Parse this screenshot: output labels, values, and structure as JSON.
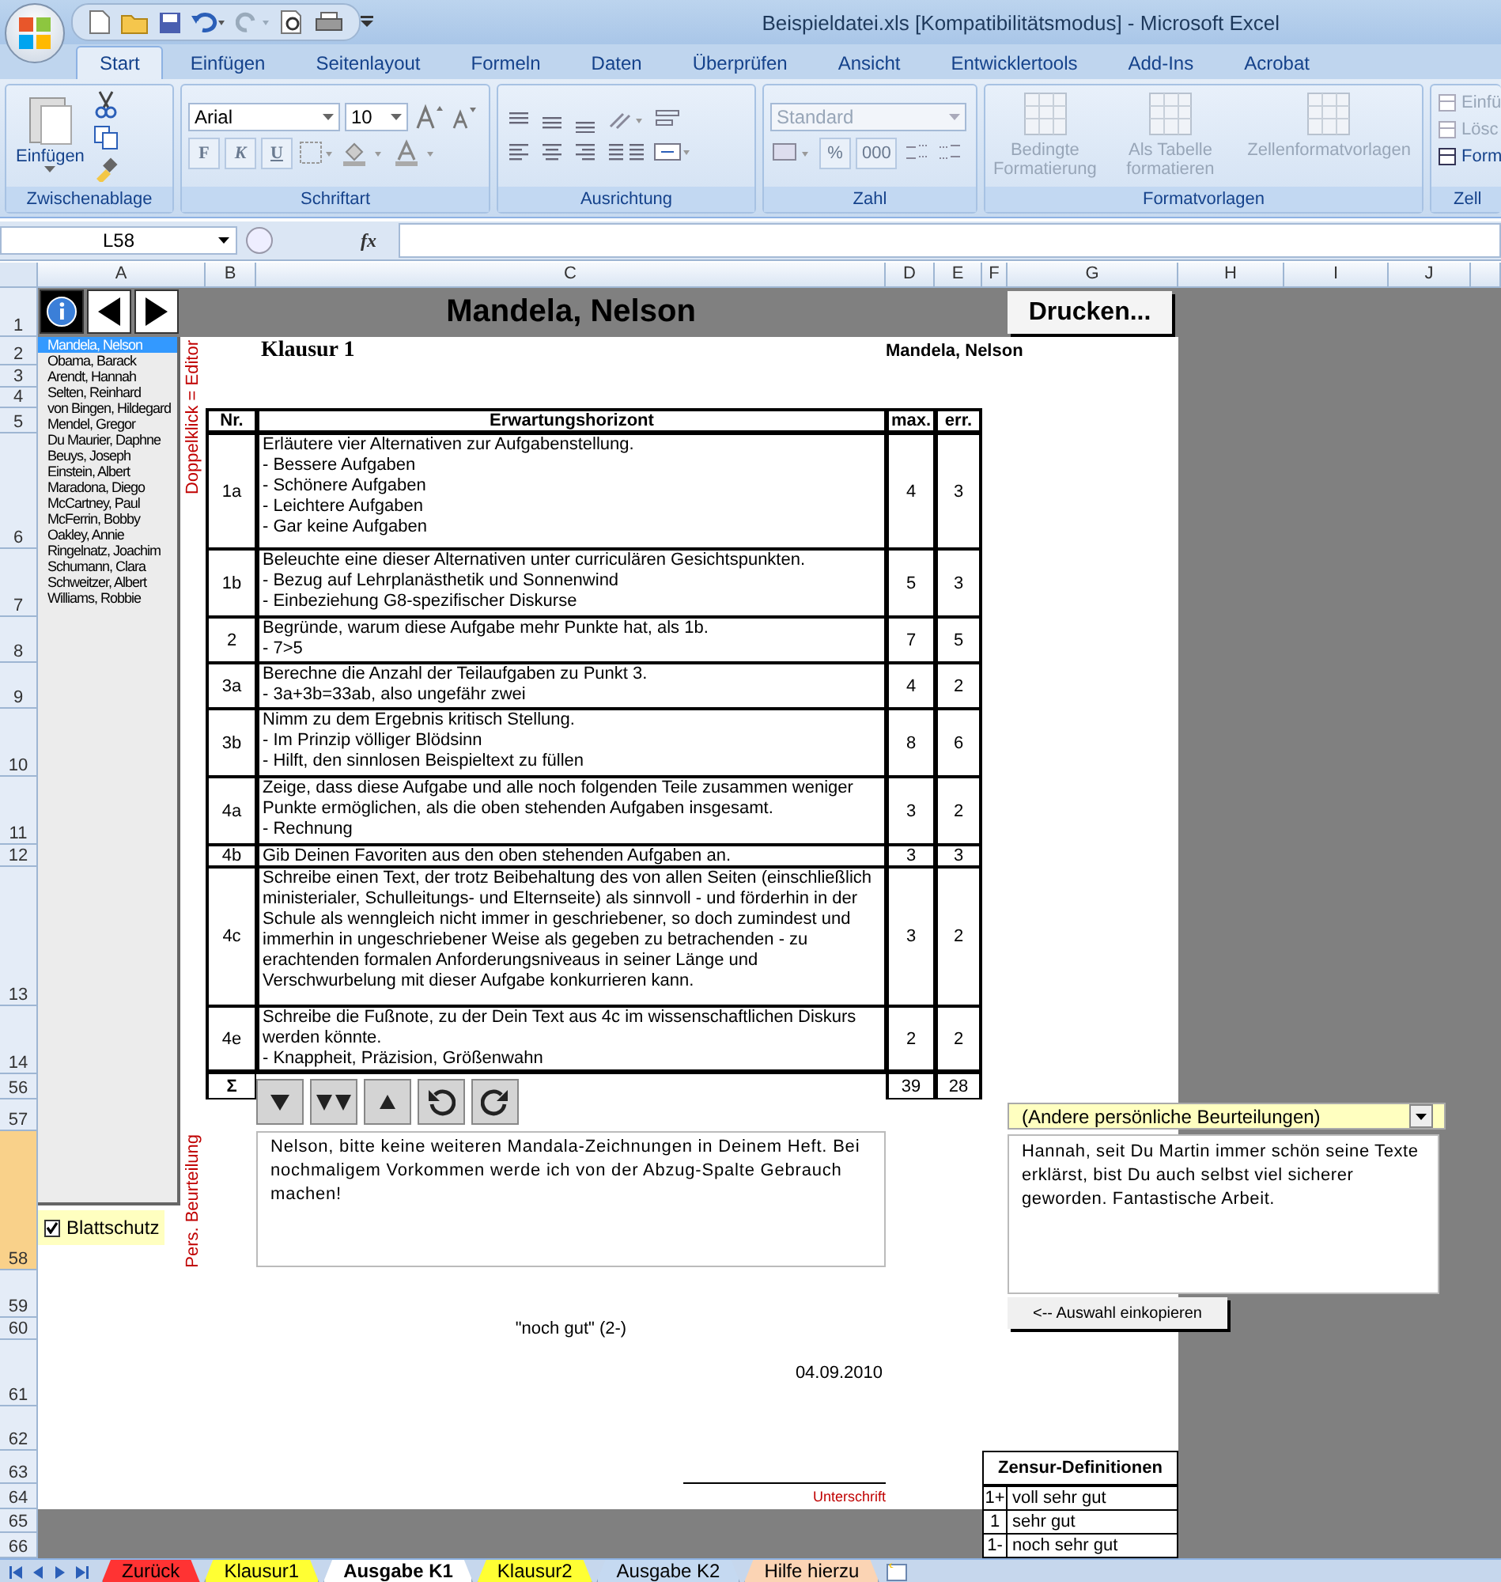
{
  "window": {
    "title": "Beispieldatei.xls  [Kompatibilitätsmodus] - Microsoft Excel"
  },
  "ribbon_tabs": [
    {
      "label": "Start",
      "selected": true
    },
    {
      "label": "Einfügen",
      "selected": false
    },
    {
      "label": "Seitenlayout",
      "selected": false
    },
    {
      "label": "Formeln",
      "selected": false
    },
    {
      "label": "Daten",
      "selected": false
    },
    {
      "label": "Überprüfen",
      "selected": false
    },
    {
      "label": "Ansicht",
      "selected": false
    },
    {
      "label": "Entwicklertools",
      "selected": false
    },
    {
      "label": "Add-Ins",
      "selected": false
    },
    {
      "label": "Acrobat",
      "selected": false
    }
  ],
  "ribbon": {
    "clipboard": {
      "paste": "Einfügen",
      "group": "Zwischenablage"
    },
    "font": {
      "family": "Arial",
      "size": "10",
      "bold": "F",
      "italic": "K",
      "underline": "U",
      "group": "Schriftart"
    },
    "alignment": {
      "group": "Ausrichtung"
    },
    "number": {
      "format": "Standard",
      "percent": "%",
      "thousands": "000",
      "group": "Zahl"
    },
    "styles": {
      "group": "Formatvorlagen",
      "items": [
        {
          "label": "Bedingte Formatierung",
          "disabled": true
        },
        {
          "label": "Als Tabelle formatieren",
          "disabled": true
        },
        {
          "label": "Zellenformatvorlagen",
          "disabled": true
        }
      ]
    },
    "cells": {
      "group": "Zell",
      "items": [
        {
          "label": "Einfü",
          "disabled": true
        },
        {
          "label": "Lösc",
          "disabled": true
        },
        {
          "label": "Form",
          "disabled": false
        }
      ]
    }
  },
  "formula_bar": {
    "name_box": "L58",
    "fx": "fx"
  },
  "columns": [
    "A",
    "B",
    "C",
    "D",
    "E",
    "F",
    "G",
    "H",
    "I",
    "J"
  ],
  "rows": [
    {
      "label": "1",
      "selected": false
    },
    {
      "label": "2",
      "selected": false
    },
    {
      "label": "3",
      "selected": false
    },
    {
      "label": "4",
      "selected": false
    },
    {
      "label": "5",
      "selected": false
    },
    {
      "label": "6",
      "selected": false
    },
    {
      "label": "7",
      "selected": false
    },
    {
      "label": "8",
      "selected": false
    },
    {
      "label": "9",
      "selected": false
    },
    {
      "label": "10",
      "selected": false
    },
    {
      "label": "11",
      "selected": false
    },
    {
      "label": "12",
      "selected": false
    },
    {
      "label": "13",
      "selected": false
    },
    {
      "label": "14",
      "selected": false
    },
    {
      "label": "56",
      "selected": false
    },
    {
      "label": "57",
      "selected": false
    },
    {
      "label": "58",
      "selected": true
    },
    {
      "label": "59",
      "selected": false
    },
    {
      "label": "60",
      "selected": false
    },
    {
      "label": "61",
      "selected": false
    },
    {
      "label": "62",
      "selected": false
    },
    {
      "label": "63",
      "selected": false
    },
    {
      "label": "64",
      "selected": false
    },
    {
      "label": "65",
      "selected": false
    },
    {
      "label": "66",
      "selected": false
    }
  ],
  "sheet": {
    "header_title": "Mandela, Nelson",
    "print_button": "Drucken...",
    "students": [
      {
        "name": "Mandela, Nelson",
        "selected": true
      },
      {
        "name": "Obama, Barack",
        "selected": false
      },
      {
        "name": "Arendt, Hannah",
        "selected": false
      },
      {
        "name": "Selten, Reinhard",
        "selected": false
      },
      {
        "name": "von Bingen, Hildegard",
        "selected": false
      },
      {
        "name": "Mendel, Gregor",
        "selected": false
      },
      {
        "name": "Du Maurier, Daphne",
        "selected": false
      },
      {
        "name": "Beuys, Joseph",
        "selected": false
      },
      {
        "name": "Einstein, Albert",
        "selected": false
      },
      {
        "name": "Maradona, Diego",
        "selected": false
      },
      {
        "name": "McCartney, Paul",
        "selected": false
      },
      {
        "name": "McFerrin, Bobby",
        "selected": false
      },
      {
        "name": "Oakley, Annie",
        "selected": false
      },
      {
        "name": "Ringelnatz, Joachim",
        "selected": false
      },
      {
        "name": "Schumann, Clara",
        "selected": false
      },
      {
        "name": "Schweitzer, Albert",
        "selected": false
      },
      {
        "name": "Williams, Robbie",
        "selected": false
      }
    ],
    "sheet_protection": {
      "label": "Blattschutz",
      "checked": true
    },
    "editor_hint": "Doppelklick = Editor",
    "comment_label": "Pers. Beurteilung",
    "exam_title": "Klausur 1",
    "student_name": "Mandela, Nelson",
    "table": {
      "columns": [
        "Nr.",
        "Erwartungshorizont",
        "max.",
        "err."
      ],
      "rows": [
        {
          "nr": "1a",
          "lines": [
            "Erläutere vier Alternativen zur Aufgabenstellung.",
            "- Bessere Aufgaben",
            "- Schönere Aufgaben",
            "- Leichtere Aufgaben",
            "- Gar keine Aufgaben"
          ],
          "max": "4",
          "err": "3"
        },
        {
          "nr": "1b",
          "lines": [
            "Beleuchte eine dieser Alternativen unter curriculären Gesichtspunkten.",
            "- Bezug auf Lehrplanästhetik und Sonnenwind",
            "- Einbeziehung G8-spezifischer Diskurse"
          ],
          "max": "5",
          "err": "3"
        },
        {
          "nr": "2",
          "lines": [
            "Begründe, warum diese Aufgabe mehr Punkte hat, als 1b.",
            "- 7>5"
          ],
          "max": "7",
          "err": "5"
        },
        {
          "nr": "3a",
          "lines": [
            "Berechne die Anzahl der Teilaufgaben zu Punkt 3.",
            "- 3a+3b=33ab, also ungefähr zwei"
          ],
          "max": "4",
          "err": "2"
        },
        {
          "nr": "3b",
          "lines": [
            "Nimm zu dem Ergebnis kritisch Stellung.",
            "- Im Prinzip völliger Blödsinn",
            "- Hilft, den sinnlosen Beispieltext zu füllen"
          ],
          "max": "8",
          "err": "6"
        },
        {
          "nr": "4a",
          "lines": [
            "Zeige, dass diese Aufgabe und alle noch folgenden Teile zusammen weniger",
            "Punkte ermöglichen, als die oben stehenden Aufgaben insgesamt.",
            "- Rechnung"
          ],
          "max": "3",
          "err": "2"
        },
        {
          "nr": "4b",
          "lines": [
            "Gib Deinen Favoriten aus den oben stehenden Aufgaben an."
          ],
          "max": "3",
          "err": "3"
        },
        {
          "nr": "4c",
          "lines": [
            "Schreibe einen Text, der trotz Beibehaltung des von allen Seiten (einschließlich",
            "ministerialer, Schulleitungs- und Elternseite) als sinnvoll - und förderhin in der",
            "Schule als wenngleich nicht immer in geschriebener, so doch zumindest und",
            "immerhin in ungeschriebener Weise als gegeben zu betrachenden - zu",
            "erachtenden formalen Anforderungsniveaus in seiner Länge und",
            "Verschwurbelung mit dieser Aufgabe konkurrieren kann."
          ],
          "max": "3",
          "err": "2"
        },
        {
          "nr": "4e",
          "lines": [
            "Schreibe die Fußnote, zu der Dein Text aus 4c im wissenschaftlichen Diskurs",
            "werden könnte.",
            "- Knappheit, Präzision, Größenwahn"
          ],
          "max": "2",
          "err": "2"
        }
      ],
      "total": {
        "label": "Σ",
        "max": "39",
        "err": "28"
      }
    },
    "comment": "Nelson, bitte keine weiteren Mandala-Zeichnungen in Deinem Heft. Bei nochmaligem Vorkommen werde ich von der Abzug-Spalte Gebrauch machen!",
    "other_comments": {
      "dropdown": "(Andere persönliche Beurteilungen)",
      "text": "Hannah, seit Du Martin immer schön seine Texte erklärst, bist Du auch selbst viel sicherer geworden. Fantastische Arbeit.",
      "button": "<-- Auswahl einkopieren"
    },
    "grade": "\"noch gut\" (2-)",
    "date": "04.09.2010",
    "signature_label": "Unterschrift",
    "grade_definitions": {
      "title": "Zensur-Definitionen",
      "rows": [
        {
          "grade": "1+",
          "label": "voll sehr gut"
        },
        {
          "grade": "1",
          "label": "sehr gut"
        },
        {
          "grade": "1-",
          "label": "noch sehr gut"
        }
      ]
    }
  },
  "sheet_tabs": [
    {
      "label": "Zurück",
      "color": "#ff3333",
      "selected": false
    },
    {
      "label": "Klausur1",
      "color": "#ffff33",
      "selected": false
    },
    {
      "label": "Ausgabe K1",
      "color": "#ffffff",
      "selected": true
    },
    {
      "label": "Klausur2",
      "color": "#ffff33",
      "selected": false
    },
    {
      "label": "Ausgabe K2",
      "color": "#c5d9f1",
      "selected": false
    },
    {
      "label": "Hilfe hierzu",
      "color": "#fbd4b4",
      "selected": false
    }
  ]
}
